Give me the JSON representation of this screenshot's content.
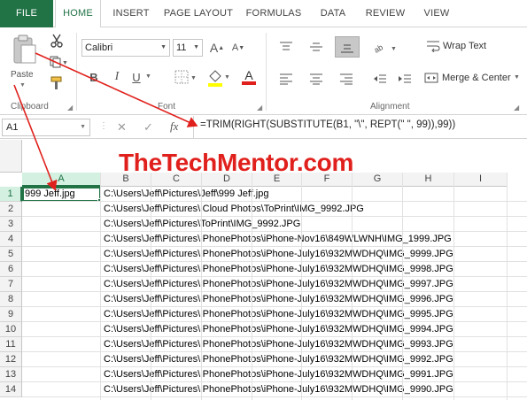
{
  "tabs": [
    "FILE",
    "HOME",
    "INSERT",
    "PAGE LAYOUT",
    "FORMULAS",
    "DATA",
    "REVIEW",
    "VIEW"
  ],
  "ribbon": {
    "clipboard": {
      "paste_label": "Paste",
      "group_label": "Clipboard"
    },
    "font": {
      "name": "Calibri",
      "size": "11",
      "bold": "B",
      "italic": "I",
      "underline": "U",
      "grow": "A",
      "shrink": "A",
      "font_color_glyph": "A",
      "group_label": "Font",
      "highlight_color": "#ffff00",
      "font_color": "#e0201c"
    },
    "alignment": {
      "wrap_text": "Wrap Text",
      "merge_center": "Merge & Center",
      "group_label": "Alignment"
    }
  },
  "formula_bar": {
    "name_box": "A1",
    "fx": "fx",
    "formula": "=TRIM(RIGHT(SUBSTITUTE(B1, \"\\\", REPT(\" \", 99)),99))"
  },
  "watermark": "TheTechMentor.com",
  "columns": [
    "A",
    "B",
    "C",
    "D",
    "E",
    "F",
    "G",
    "H",
    "I"
  ],
  "rows": [
    {
      "n": "1",
      "a": "999 Jeff.jpg",
      "b": "C:\\Users\\Jeff\\Pictures\\Jeff\\999 Jeff.jpg"
    },
    {
      "n": "2",
      "a": "",
      "b": "C:\\Users\\Jeff\\Pictures\\iCloud Photos\\ToPrint\\IMG_9992.JPG"
    },
    {
      "n": "3",
      "a": "",
      "b": "C:\\Users\\Jeff\\Pictures\\ToPrint\\IMG_9992.JPG"
    },
    {
      "n": "4",
      "a": "",
      "b": "C:\\Users\\Jeff\\Pictures\\iPhonePhotos\\iPhone-Nov16\\849WLWNH\\IMG_1999.JPG"
    },
    {
      "n": "5",
      "a": "",
      "b": "C:\\Users\\Jeff\\Pictures\\iPhonePhotos\\iPhone-July16\\932MWDHQ\\IMG_9999.JPG"
    },
    {
      "n": "6",
      "a": "",
      "b": "C:\\Users\\Jeff\\Pictures\\iPhonePhotos\\iPhone-July16\\932MWDHQ\\IMG_9998.JPG"
    },
    {
      "n": "7",
      "a": "",
      "b": "C:\\Users\\Jeff\\Pictures\\iPhonePhotos\\iPhone-July16\\932MWDHQ\\IMG_9997.JPG"
    },
    {
      "n": "8",
      "a": "",
      "b": "C:\\Users\\Jeff\\Pictures\\iPhonePhotos\\iPhone-July16\\932MWDHQ\\IMG_9996.JPG"
    },
    {
      "n": "9",
      "a": "",
      "b": "C:\\Users\\Jeff\\Pictures\\iPhonePhotos\\iPhone-July16\\932MWDHQ\\IMG_9995.JPG"
    },
    {
      "n": "10",
      "a": "",
      "b": "C:\\Users\\Jeff\\Pictures\\iPhonePhotos\\iPhone-July16\\932MWDHQ\\IMG_9994.JPG"
    },
    {
      "n": "11",
      "a": "",
      "b": "C:\\Users\\Jeff\\Pictures\\iPhonePhotos\\iPhone-July16\\932MWDHQ\\IMG_9993.JPG"
    },
    {
      "n": "12",
      "a": "",
      "b": "C:\\Users\\Jeff\\Pictures\\iPhonePhotos\\iPhone-July16\\932MWDHQ\\IMG_9992.JPG"
    },
    {
      "n": "13",
      "a": "",
      "b": "C:\\Users\\Jeff\\Pictures\\iPhonePhotos\\iPhone-July16\\932MWDHQ\\IMG_9991.JPG"
    },
    {
      "n": "14",
      "a": "",
      "b": "C:\\Users\\Jeff\\Pictures\\iPhonePhotos\\iPhone-July16\\932MWDHQ\\IMG_9990.JPG"
    }
  ],
  "colors": {
    "accent": "#217346",
    "annotation": "#e0201c"
  }
}
